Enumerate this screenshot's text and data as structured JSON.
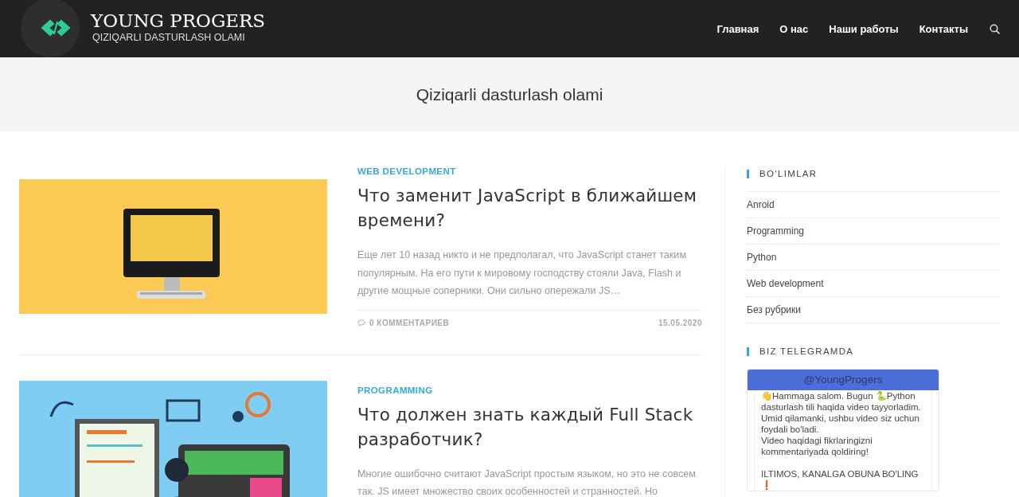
{
  "header": {
    "site_title": "YOUNG PROGERS",
    "tagline": "QIZIQARLI DASTURLASH OLAMI",
    "nav": [
      {
        "label": "Главная"
      },
      {
        "label": "О нас"
      },
      {
        "label": "Наши работы"
      },
      {
        "label": "Контакты"
      }
    ]
  },
  "banner": {
    "title": "Qiziqarli dasturlash olami"
  },
  "posts": [
    {
      "category": "WEB DEVELOPMENT",
      "title": "Что заменит JavaScript в ближайшем времени?",
      "excerpt": "Еще лет 10 назад никто и не предполагал, что JavaScript станет таким популярным. На его пути к мировому господству стояли Java, Flash и другие мощные соперники. Они сильно опережали JS…",
      "comments": "0 КОММЕНТАРИЕВ",
      "date": "15.05.2020"
    },
    {
      "category": "PROGRAMMING",
      "title": "Что должен знать каждый Full Stack разработчик?",
      "excerpt": "Многие ошибочно считают JavaScript простым языком, но это не совсем так. JS имеет множество своих особенностей и странностей. Но"
    }
  ],
  "sidebar": {
    "widgets": [
      {
        "kind": "list",
        "title": "BO‘LIMLAR",
        "items": [
          {
            "label": "Anroid"
          },
          {
            "label": "Programming"
          },
          {
            "label": "Python"
          },
          {
            "label": "Web development"
          },
          {
            "label": "Без рубрики"
          }
        ]
      },
      {
        "kind": "telegram",
        "title": "BIZ TELEGRAMDA",
        "channel": "@YoungProgers",
        "message": "👋Hammaga salom. Bugun 🐍Python dasturlash tili haqida video tayyorladim. Umid qilamanki, ushbu video siz uchun foydali bo'ladi.\nVideo haqidagi fikrlaringizni kommentariyada qoldiring!\n\nILTIMOS, KANALGA OBUNA BO'LING\n❗"
      }
    ]
  }
}
